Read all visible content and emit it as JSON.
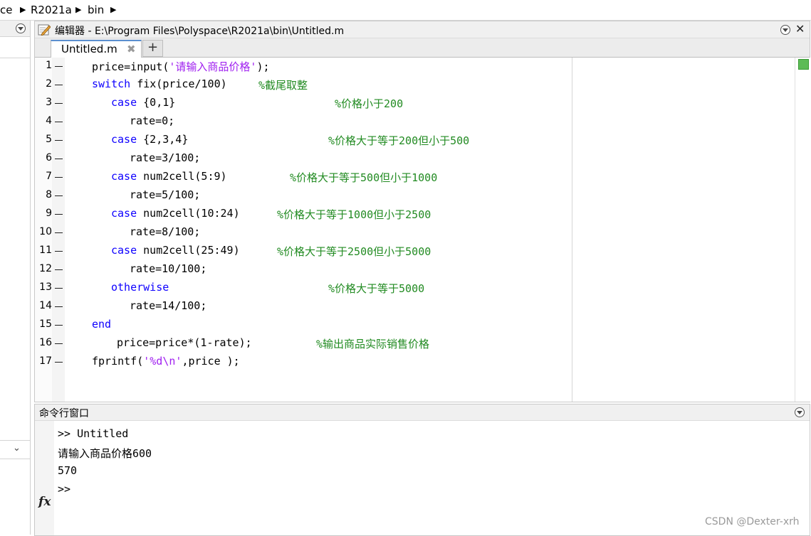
{
  "breadcrumb": {
    "items": [
      "ce",
      "R2021a",
      "bin"
    ]
  },
  "editor": {
    "title": "编辑器 - E:\\Program Files\\Polyspace\\R2021a\\bin\\Untitled.m",
    "tab_label": "Untitled.m",
    "tab_close": "✖",
    "tab_add": "+",
    "lines": [
      {
        "n": "1",
        "parts": [
          {
            "t": "price=input(",
            "c": "n"
          },
          {
            "t": "'请输入商品价格'",
            "c": "s"
          },
          {
            "t": ");",
            "c": "n"
          }
        ],
        "indent": 1,
        "comment": ""
      },
      {
        "n": "2",
        "parts": [
          {
            "t": "switch",
            "c": "k"
          },
          {
            "t": " fix(price/100)",
            "c": "n"
          }
        ],
        "indent": 1,
        "comment": "%截尾取整"
      },
      {
        "n": "3",
        "parts": [
          {
            "t": "case",
            "c": "k"
          },
          {
            "t": " {0,1}",
            "c": "n"
          }
        ],
        "indent": 2,
        "comment": "%价格小于200"
      },
      {
        "n": "4",
        "parts": [
          {
            "t": "rate=0;",
            "c": "n"
          }
        ],
        "indent": 3,
        "comment": ""
      },
      {
        "n": "5",
        "parts": [
          {
            "t": "case",
            "c": "k"
          },
          {
            "t": " {2,3,4}",
            "c": "n"
          }
        ],
        "indent": 2,
        "comment": "%价格大于等于200但小于500"
      },
      {
        "n": "6",
        "parts": [
          {
            "t": "rate=3/100;",
            "c": "n"
          }
        ],
        "indent": 3,
        "comment": ""
      },
      {
        "n": "7",
        "parts": [
          {
            "t": "case",
            "c": "k"
          },
          {
            "t": " num2cell(5:9)",
            "c": "n"
          }
        ],
        "indent": 2,
        "comment": "%价格大于等于500但小于1000"
      },
      {
        "n": "8",
        "parts": [
          {
            "t": "rate=5/100;",
            "c": "n"
          }
        ],
        "indent": 3,
        "comment": ""
      },
      {
        "n": "9",
        "parts": [
          {
            "t": "case",
            "c": "k"
          },
          {
            "t": " num2cell(10:24)",
            "c": "n"
          }
        ],
        "indent": 2,
        "comment": "%价格大于等于1000但小于2500"
      },
      {
        "n": "10",
        "parts": [
          {
            "t": "rate=8/100;",
            "c": "n"
          }
        ],
        "indent": 3,
        "comment": ""
      },
      {
        "n": "11",
        "parts": [
          {
            "t": "case",
            "c": "k"
          },
          {
            "t": " num2cell(25:49)",
            "c": "n"
          }
        ],
        "indent": 2,
        "comment": "%价格大于等于2500但小于5000"
      },
      {
        "n": "12",
        "parts": [
          {
            "t": "rate=10/100;",
            "c": "n"
          }
        ],
        "indent": 3,
        "comment": ""
      },
      {
        "n": "13",
        "parts": [
          {
            "t": "otherwise",
            "c": "k"
          }
        ],
        "indent": 2,
        "comment": "%价格大于等于5000"
      },
      {
        "n": "14",
        "parts": [
          {
            "t": "rate=14/100;",
            "c": "n"
          }
        ],
        "indent": 3,
        "comment": ""
      },
      {
        "n": "15",
        "parts": [
          {
            "t": "end",
            "c": "k"
          }
        ],
        "indent": 1,
        "comment": ""
      },
      {
        "n": "16",
        "parts": [
          {
            "t": "price=price*(1-rate);",
            "c": "n"
          }
        ],
        "indent": 4,
        "comment": "%输出商品实际销售价格"
      },
      {
        "n": "17",
        "parts": [
          {
            "t": "fprintf(",
            "c": "n"
          },
          {
            "t": "'%d\\n'",
            "c": "s"
          },
          {
            "t": ",price );",
            "c": "n"
          }
        ],
        "indent": 1,
        "comment": ""
      }
    ]
  },
  "command_window": {
    "title": "命令行窗口",
    "lines": [
      ">> Untitled",
      "请输入商品价格600",
      "570",
      ">>"
    ],
    "fx_label": "fx"
  },
  "watermark": "CSDN @Dexter-xrh",
  "colors": {
    "keyword": "#0e00ff",
    "string": "#a020f0",
    "comment": "#228b22",
    "status_ok": "#5dbb56"
  }
}
